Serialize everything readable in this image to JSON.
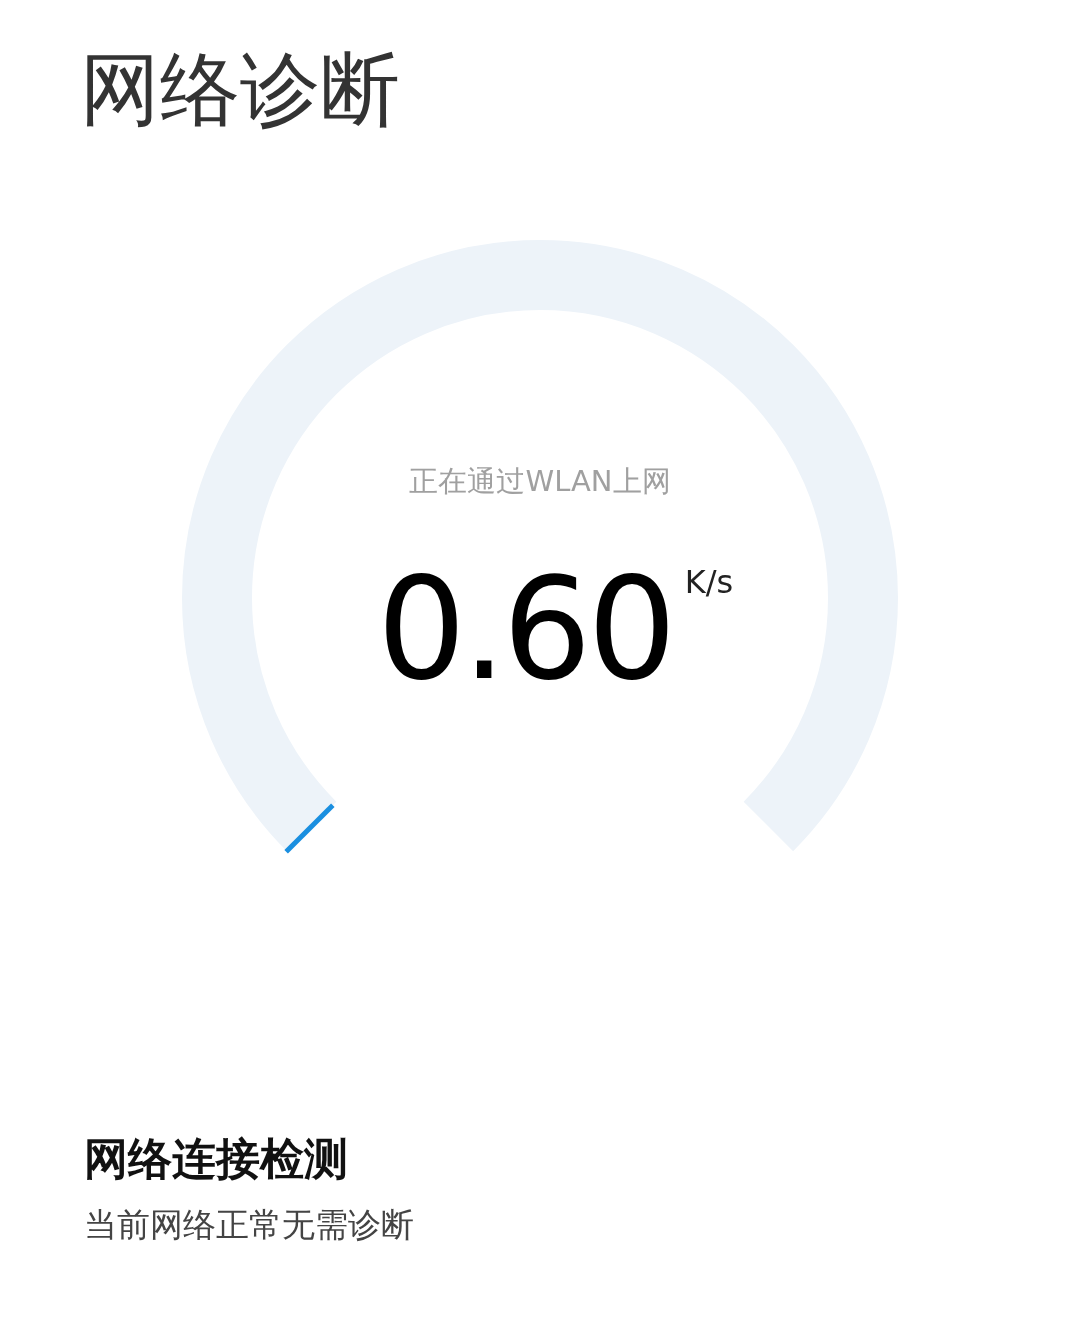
{
  "title": "网络诊断",
  "gauge": {
    "status": "正在通过WLAN上网",
    "speed": "0.60",
    "unit": "K/s"
  },
  "check": {
    "heading": "网络连接检测",
    "detail": "当前网络正常无需诊断"
  }
}
